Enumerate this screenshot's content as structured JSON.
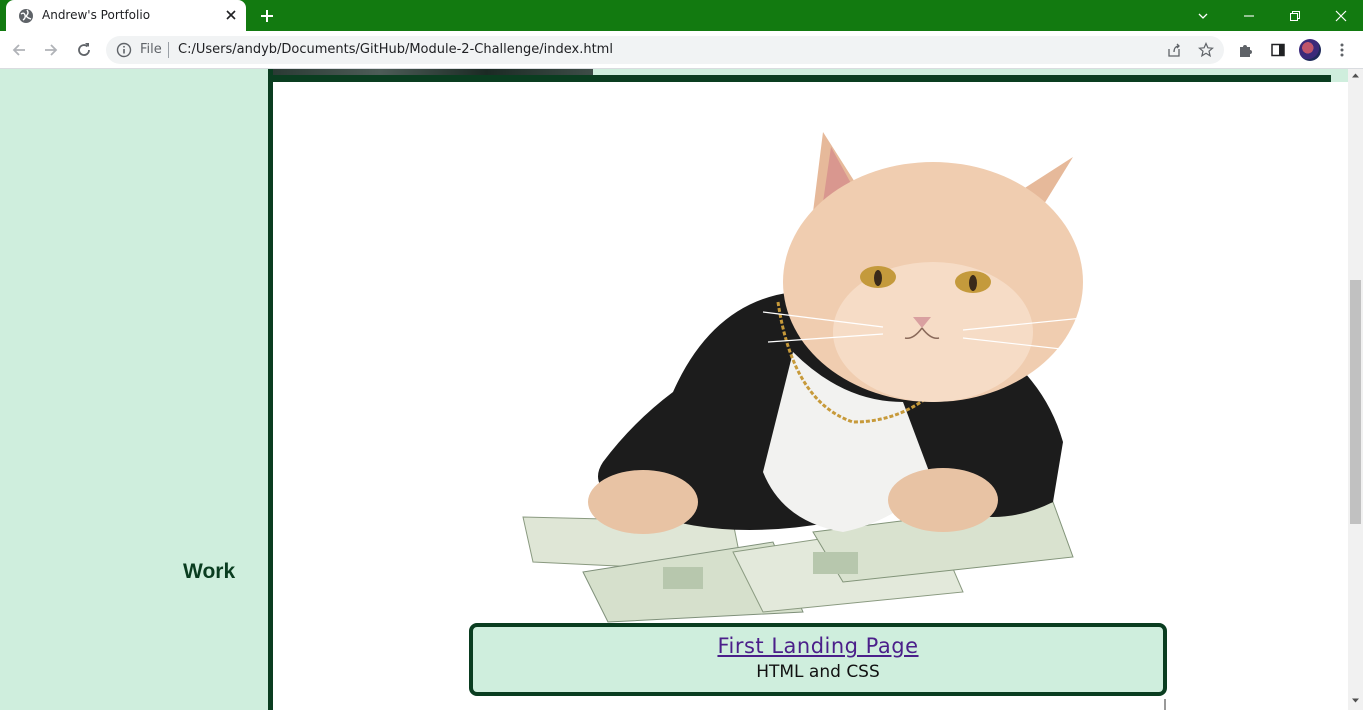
{
  "browser": {
    "tab_title": "Andrew's Portfolio",
    "omnibox_scheme": "File",
    "url": "C:/Users/andyb/Documents/GitHub/Module-2-Challenge/index.html",
    "accent_color": "#127a10"
  },
  "page": {
    "sidebar_heading": "Work",
    "project": {
      "link_text": "First Landing Page",
      "subtitle": "HTML and CSS",
      "image_description_icon": "cat-in-suit-with-money-image"
    },
    "colors": {
      "background": "#cfeedd",
      "border": "#0a3d20",
      "link": "#4b1f8a"
    }
  }
}
